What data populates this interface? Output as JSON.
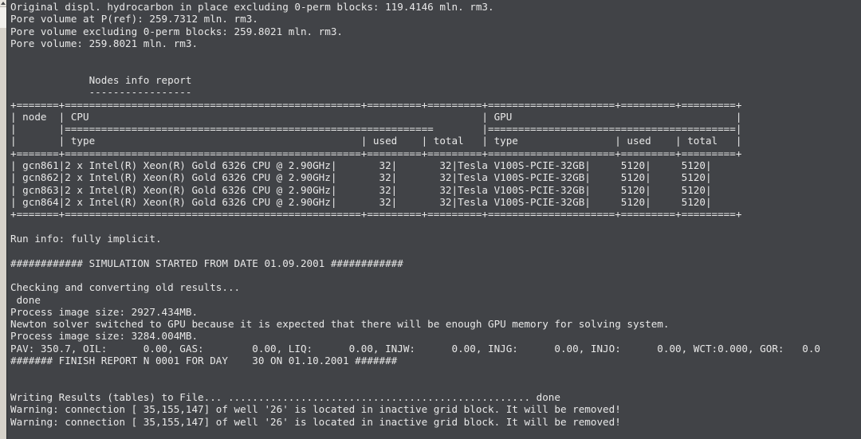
{
  "window": {
    "title": "reservoir-simulator-console",
    "background_color": "#414347",
    "text_color": "#e8e8e8"
  },
  "scrollbar": {
    "name": "vertical-scrollbar",
    "track_color": "#d6d2ca",
    "thumb_color": "#f2f0ec",
    "up_arrow_glyph": "▲",
    "position": "top"
  },
  "console": {
    "lines": [
      "Original displ. hydrocarbon in place excluding 0-perm blocks: 119.4146 mln. rm3.",
      "Pore volume at P(ref): 259.7312 mln. rm3.",
      "Pore volume excluding 0-perm blocks: 259.8021 mln. rm3.",
      "Pore volume: 259.8021 mln. rm3.",
      "",
      "",
      "             Nodes info report",
      "             -----------------",
      "+=======+=================================================+=========+=========+=====================+=========+=========+",
      "| node  | CPU                                                                 | GPU                                     |",
      "|       |=============================================================        |=========================================|",
      "|       | type                                            | used    | total   | type                | used    | total   |",
      "+=======+=================================================+=========+=========+=====================+=========+=========+",
      "| gcn861|2 x Intel(R) Xeon(R) Gold 6326 CPU @ 2.90GHz|       32|       32|Tesla V100S-PCIE-32GB|     5120|     5120|",
      "| gcn862|2 x Intel(R) Xeon(R) Gold 6326 CPU @ 2.90GHz|       32|       32|Tesla V100S-PCIE-32GB|     5120|     5120|",
      "| gcn863|2 x Intel(R) Xeon(R) Gold 6326 CPU @ 2.90GHz|       32|       32|Tesla V100S-PCIE-32GB|     5120|     5120|",
      "| gcn864|2 x Intel(R) Xeon(R) Gold 6326 CPU @ 2.90GHz|       32|       32|Tesla V100S-PCIE-32GB|     5120|     5120|",
      "+=======+=================================================+=========+=========+=====================+=========+=========+",
      "",
      "Run info: fully implicit.",
      "",
      "############ SIMULATION STARTED FROM DATE 01.09.2001 ############",
      "",
      "Checking and converting old results...",
      " done",
      "Process image size: 2927.434MB.",
      "Newton solver switched to GPU because it is expected that there will be enough GPU memory for solving system.",
      "Process image size: 3284.004MB.",
      "PAV: 350.7, OIL:      0.00, GAS:        0.00, LIQ:      0.00, INJW:      0.00, INJG:      0.00, INJO:      0.00, WCT:0.000, GOR:   0.0",
      "####### FINISH REPORT N 0001 FOR DAY    30 ON 01.10.2001 #######",
      "",
      "",
      "Writing Results (tables) to File... .................................................. done",
      "Warning: connection [ 35,155,147] of well '26' is located in inactive grid block. It will be removed!",
      "Warning: connection [ 35,155,147] of well '26' is located in inactive grid block. It will be removed!"
    ],
    "table": {
      "title": "Nodes info report",
      "columns": [
        "node",
        "CPU type",
        "CPU used",
        "CPU total",
        "GPU type",
        "GPU used",
        "GPU total"
      ],
      "rows": [
        {
          "node": "gcn861",
          "cpu_type": "2 x Intel(R) Xeon(R) Gold 6326 CPU @ 2.90GHz",
          "cpu_used": "32",
          "cpu_total": "32",
          "gpu_type": "Tesla V100S-PCIE-32GB",
          "gpu_used": "5120",
          "gpu_total": "5120"
        },
        {
          "node": "gcn862",
          "cpu_type": "2 x Intel(R) Xeon(R) Gold 6326 CPU @ 2.90GHz",
          "cpu_used": "32",
          "cpu_total": "32",
          "gpu_type": "Tesla V100S-PCIE-32GB",
          "gpu_used": "5120",
          "gpu_total": "5120"
        },
        {
          "node": "gcn863",
          "cpu_type": "2 x Intel(R) Xeon(R) Gold 6326 CPU @ 2.90GHz",
          "cpu_used": "32",
          "cpu_total": "32",
          "gpu_type": "Tesla V100S-PCIE-32GB",
          "gpu_used": "5120",
          "gpu_total": "5120"
        },
        {
          "node": "gcn864",
          "cpu_type": "2 x Intel(R) Xeon(R) Gold 6326 CPU @ 2.90GHz",
          "cpu_used": "32",
          "cpu_total": "32",
          "gpu_type": "Tesla V100S-PCIE-32GB",
          "gpu_used": "5120",
          "gpu_total": "5120"
        }
      ]
    },
    "metrics": {
      "original_hydrocarbon_in_place": "119.4146 mln. rm3.",
      "pore_volume_at_pref": "259.7312 mln. rm3.",
      "pore_volume_excluding_zero_perm": "259.8021 mln. rm3.",
      "pore_volume": "259.8021 mln. rm3.",
      "run_info": "fully implicit.",
      "simulation_start_date": "01.09.2001",
      "process_image_size_1": "2927.434MB.",
      "process_image_size_2": "3284.004MB.",
      "pav": "350.7",
      "oil": "0.00",
      "gas": "0.00",
      "liq": "0.00",
      "injw": "0.00",
      "injg": "0.00",
      "injo": "0.00",
      "wct": "0.000",
      "gor": "0.0",
      "finish_report_number": "0001",
      "finish_report_day": "30",
      "finish_report_date": "01.10.2001"
    }
  }
}
